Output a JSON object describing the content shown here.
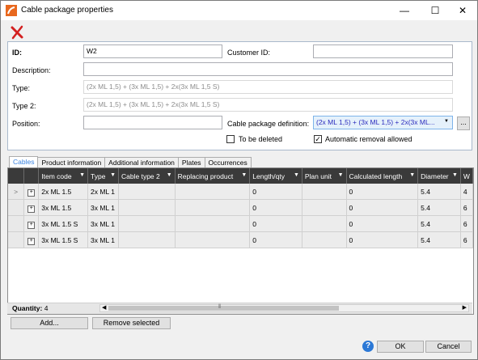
{
  "window": {
    "title": "Cable package properties",
    "controls": {
      "minimize": "—",
      "maximize": "☐",
      "close": "✕"
    }
  },
  "toolbar": {
    "delete_icon": "red-x-icon"
  },
  "fields": {
    "id_label": "ID:",
    "id_value": "W2",
    "customer_id_label": "Customer ID:",
    "customer_id_value": "",
    "description_label": "Description:",
    "description_value": "",
    "type_label": "Type:",
    "type_value": "(2x ML 1,5) + (3x ML 1,5) + 2x(3x ML 1,5 S)",
    "type2_label": "Type 2:",
    "type2_value": "(2x ML 1,5) + (3x ML 1,5) + 2x(3x ML 1,5 S)",
    "position_label": "Position:",
    "position_value": "",
    "cable_def_label": "Cable package definition:",
    "cable_def_value": "(2x ML 1,5) + (3x ML 1,5) + 2x(3x ML...",
    "browse_label": "...",
    "to_be_deleted_label": "To be deleted",
    "to_be_deleted_checked": false,
    "auto_removal_label": "Automatic removal allowed",
    "auto_removal_checked": true
  },
  "tabs": [
    "Cables",
    "Product information",
    "Additional information",
    "Plates",
    "Occurrences"
  ],
  "grid": {
    "columns": [
      "Item code",
      "Type",
      "Cable type 2",
      "Replacing product",
      "Length/qty",
      "Plan unit",
      "Calculated length",
      "Diameter",
      "W"
    ],
    "rows": [
      {
        "selector": ">",
        "cells": [
          "2x ML 1.5",
          "2x ML 1",
          "",
          "",
          "0",
          "",
          "0",
          "5.4",
          "4"
        ]
      },
      {
        "selector": "",
        "cells": [
          "3x ML 1.5",
          "3x ML 1",
          "",
          "",
          "0",
          "",
          "0",
          "5.4",
          "6"
        ]
      },
      {
        "selector": "",
        "cells": [
          "3x ML 1.5 S",
          "3x ML 1",
          "",
          "",
          "0",
          "",
          "0",
          "5.4",
          "6"
        ]
      },
      {
        "selector": "",
        "cells": [
          "3x ML 1.5 S",
          "3x ML 1",
          "",
          "",
          "0",
          "",
          "0",
          "5.4",
          "6"
        ]
      }
    ]
  },
  "footer": {
    "quantity_label": "Quantity:",
    "quantity_value": "4"
  },
  "buttons": {
    "add": "Add...",
    "remove": "Remove selected",
    "ok": "OK",
    "cancel": "Cancel",
    "help": "?"
  }
}
